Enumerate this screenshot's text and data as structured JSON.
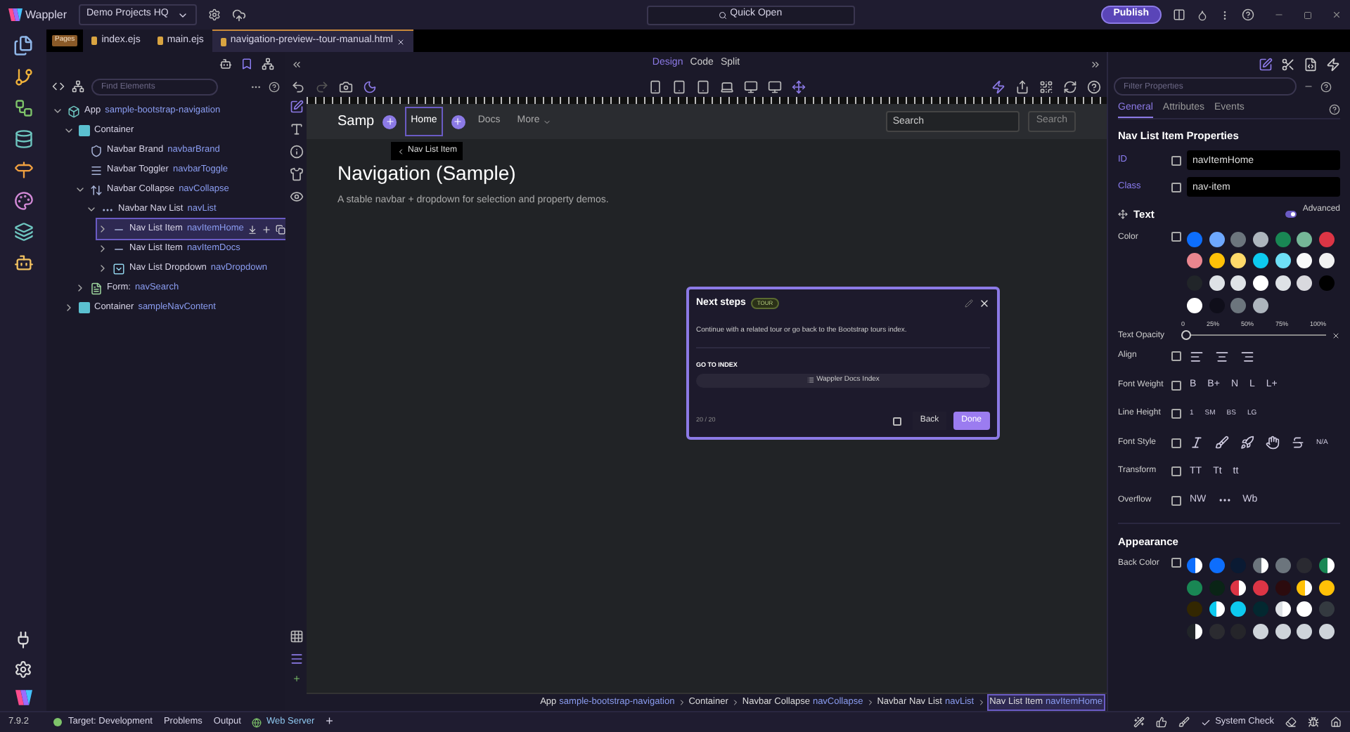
{
  "app": {
    "name": "Wappler",
    "project": "Demo Projects HQ",
    "quick_open": "Quick Open",
    "publish": "Publish"
  },
  "file_tabs": [
    {
      "label": "Pages",
      "kind": "badge",
      "selected": false
    },
    {
      "label": "index.ejs",
      "kind": "file",
      "selected": false
    },
    {
      "label": "main.ejs",
      "kind": "file",
      "selected": false
    },
    {
      "label": "navigation-preview--tour-manual.html",
      "kind": "file",
      "selected": true
    }
  ],
  "left_panel": {
    "search_placeholder": "Find Elements",
    "tree": [
      {
        "label": "App",
        "ref": "sample-bootstrap-navigation",
        "kind": "app",
        "expanded": true,
        "selected": false,
        "children": [
          {
            "label": "Container",
            "kind": "box",
            "expanded": true,
            "selected": false,
            "children": [
              {
                "label": "Navbar Brand",
                "ref": "navbarBrand",
                "kind": "shield",
                "selected": false
              },
              {
                "label": "Navbar Toggler",
                "ref": "navbarToggle",
                "kind": "menu",
                "selected": false
              },
              {
                "label": "Navbar Collapse",
                "ref": "navCollapse",
                "kind": "vertical",
                "expanded": true,
                "selected": false,
                "children": [
                  {
                    "label": "Navbar Nav List",
                    "ref": "navList",
                    "kind": "dots",
                    "expanded": true,
                    "selected": false,
                    "children": [
                      {
                        "label": "Nav List Item",
                        "ref": "navItemHome",
                        "kind": "dash",
                        "expanded": false,
                        "selected": true
                      },
                      {
                        "label": "Nav List Item",
                        "ref": "navItemDocs",
                        "kind": "dash",
                        "expanded": false,
                        "selected": false
                      },
                      {
                        "label": "Nav List Dropdown",
                        "ref": "navDropdown",
                        "kind": "dropdown",
                        "expanded": false,
                        "selected": false
                      }
                    ]
                  }
                ]
              },
              {
                "label": "Form:",
                "ref": "navSearch",
                "kind": "form",
                "expanded": false,
                "selected": false
              }
            ]
          },
          {
            "label": "Container",
            "ref": "sampleNavContent",
            "kind": "box",
            "expanded": false,
            "selected": false
          }
        ]
      }
    ]
  },
  "view_modes": [
    {
      "label": "Design",
      "selected": true
    },
    {
      "label": "Code",
      "selected": false
    },
    {
      "label": "Split",
      "selected": false
    }
  ],
  "canvas": {
    "brand": "Samp",
    "nav_items": [
      {
        "label": "Home",
        "selected": true
      },
      {
        "label": "Docs",
        "selected": false
      },
      {
        "label": "More",
        "selected": false
      }
    ],
    "tooltip": "Nav List Item",
    "search_placeholder": "Search",
    "search_button": "Search",
    "heading": "Navigation (Sample)",
    "lead": "A stable navbar + dropdown for selection and property demos."
  },
  "tour": {
    "title": "Next steps",
    "badge": "TOUR",
    "body": "Continue with a related tour or go back to the Bootstrap tours index.",
    "section": "GO TO INDEX",
    "link": "Wappler Docs Index",
    "counter": "20 / 20",
    "checked": false,
    "back": "Back",
    "done": "Done"
  },
  "breadcrumb": [
    {
      "label": "App",
      "ref": "sample-bootstrap-navigation",
      "selected": false
    },
    {
      "label": "Container",
      "selected": false
    },
    {
      "label": "Navbar Collapse",
      "ref": "navCollapse",
      "selected": false
    },
    {
      "label": "Navbar Nav List",
      "ref": "navList",
      "selected": false
    },
    {
      "label": "Nav List Item",
      "ref": "navItemHome",
      "selected": true
    }
  ],
  "right_panel": {
    "filter_placeholder": "Filter Properties",
    "tabs": [
      {
        "label": "General",
        "selected": true
      },
      {
        "label": "Attributes",
        "selected": false
      },
      {
        "label": "Events",
        "selected": false
      }
    ],
    "title": "Nav List Item Properties",
    "fields": [
      {
        "label": "ID",
        "value": "navItemHome"
      },
      {
        "label": "Class",
        "value": "nav-item"
      }
    ],
    "text_section": "Text",
    "advanced": {
      "label": "Advanced",
      "on": true
    },
    "color_label": "Color",
    "colors": [
      {
        "color": "#0d6efd"
      },
      {
        "color": "#6ea8fe"
      },
      {
        "color": "#6c757d"
      },
      {
        "color": "#adb5bd"
      },
      {
        "color": "#198754"
      },
      {
        "color": "#75b798"
      },
      {
        "color": "#dc3545"
      },
      {
        "color": "#ea868f"
      },
      {
        "color": "#ffc107"
      },
      {
        "color": "#ffda6a"
      },
      {
        "color": "#0dcaf0"
      },
      {
        "color": "#6edff6"
      },
      {
        "color": "#f8f9fa"
      },
      {
        "color": "#f1f1f1"
      },
      {
        "color": "#212529"
      },
      {
        "color": "#dee2e6"
      },
      {
        "color": "#dee2e6"
      },
      {
        "color": "#ffffff"
      },
      {
        "color": "#dee2e6"
      },
      {
        "color": "#d9d9de"
      },
      {
        "color": "#000000"
      },
      {
        "color": "#ffffff"
      },
      {
        "color": "#0f0e1a"
      },
      {
        "color": "#6c757d"
      },
      {
        "color": "#adb5bd"
      }
    ],
    "opacity": {
      "label": "Text Opacity",
      "level": 0,
      "ticks": [
        "0",
        "25%",
        "50%",
        "75%",
        "100%"
      ]
    },
    "rows": [
      {
        "label": "Align",
        "kind": "align"
      },
      {
        "label": "Font Weight",
        "kind": "options",
        "options": [
          "B",
          "B+",
          "N",
          "L",
          "L+"
        ]
      },
      {
        "label": "Line Height",
        "kind": "small_options",
        "options": [
          "1",
          "SM",
          "BS",
          "LG"
        ]
      },
      {
        "label": "Font Style",
        "kind": "font_style",
        "options": [
          "N/A"
        ]
      },
      {
        "label": "Transform",
        "kind": "options",
        "options": [
          "TT",
          "Tt",
          "tt"
        ]
      },
      {
        "label": "Overflow",
        "kind": "overflow",
        "options": [
          "NW",
          "Wb"
        ]
      }
    ],
    "appearance": "Appearance",
    "back_label": "Back Color",
    "back_colors": [
      {
        "color": "#0d6efd",
        "kind": "split"
      },
      {
        "color": "#0d6efd"
      },
      {
        "color": "#0a1a33"
      },
      {
        "color": "#6c757d",
        "kind": "split"
      },
      {
        "color": "#6c757d"
      },
      {
        "color": "#2a2a31"
      },
      {
        "color": "#198754",
        "kind": "split"
      },
      {
        "color": "#198754"
      },
      {
        "color": "#0a2416"
      },
      {
        "color": "#dc3545",
        "kind": "split"
      },
      {
        "color": "#dc3545"
      },
      {
        "color": "#2c0b0e"
      },
      {
        "color": "#ffc107",
        "kind": "split"
      },
      {
        "color": "#ffc107"
      },
      {
        "color": "#332701"
      },
      {
        "color": "#0dcaf0",
        "kind": "split"
      },
      {
        "color": "#0dcaf0"
      },
      {
        "color": "#032830"
      },
      {
        "color": "#dee2e6",
        "kind": "split"
      },
      {
        "color": "#ffffff"
      },
      {
        "color": "#343a40"
      },
      {
        "color": "#212529",
        "kind": "split"
      },
      {
        "color": "#2b2b30"
      },
      {
        "color": "#25252a"
      },
      {
        "color": "#ced4da"
      },
      {
        "color": "#ced4da"
      },
      {
        "color": "#ced4da"
      },
      {
        "color": "#ced4da"
      }
    ]
  },
  "status_bar": {
    "version": "7.9.2",
    "target": "Target: Development",
    "problems": "Problems",
    "output": "Output",
    "server": "Web Server",
    "add": "+",
    "system_check": "System Check"
  }
}
